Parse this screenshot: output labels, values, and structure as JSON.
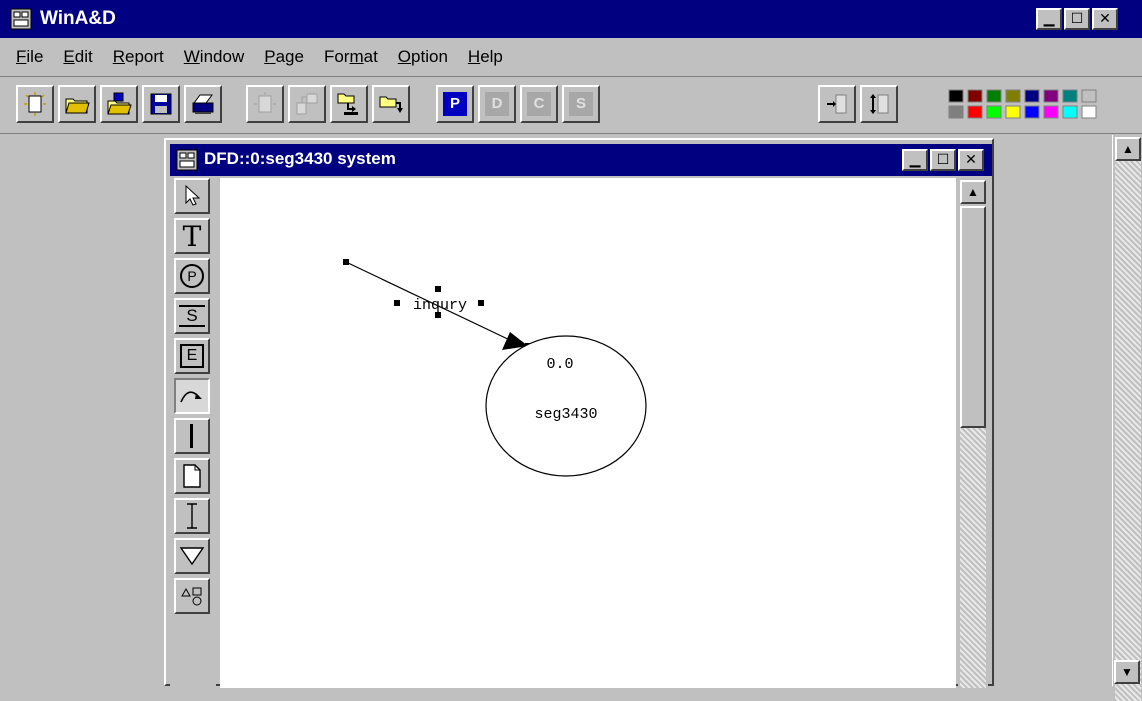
{
  "app": {
    "title": "WinA&D"
  },
  "menu": [
    {
      "pre": "",
      "u": "F",
      "post": "ile"
    },
    {
      "pre": "",
      "u": "E",
      "post": "dit"
    },
    {
      "pre": "",
      "u": "R",
      "post": "eport"
    },
    {
      "pre": "",
      "u": "W",
      "post": "indow"
    },
    {
      "pre": "",
      "u": "P",
      "post": "age"
    },
    {
      "pre": "For",
      "u": "m",
      "post": "at"
    },
    {
      "pre": "",
      "u": "O",
      "post": "ption"
    },
    {
      "pre": "",
      "u": "H",
      "post": "elp"
    }
  ],
  "toolbar": {
    "buttons": [
      "new-icon",
      "open-folder-icon",
      "open-diagram-icon",
      "save-icon",
      "print-icon",
      "disabled-new-icon",
      "disabled-link-icon",
      "folder-import-icon",
      "folder-export-icon"
    ],
    "letter_buttons": [
      "P",
      "D",
      "C",
      "S"
    ],
    "swatches": [
      "#000000",
      "#800000",
      "#008000",
      "#808000",
      "#000080",
      "#800080",
      "#008080",
      "#c0c0c0",
      "#808080",
      "#ff0000",
      "#00ff00",
      "#ffff00",
      "#0000ff",
      "#ff00ff",
      "#00ffff",
      "#ffffff"
    ]
  },
  "child": {
    "title": "DFD::0:seg3430 system"
  },
  "palette": {
    "tools": [
      "pointer-icon",
      "text-tool-icon",
      "process-tool-icon",
      "store-tool-icon",
      "entity-tool-icon",
      "flow-tool-icon",
      "line-tool-icon",
      "page-tool-icon",
      "ibeam-tool-icon",
      "triangle-tool-icon",
      "shapes-tool-icon"
    ],
    "labels": {
      "text": "T",
      "process": "P",
      "store": "S",
      "entity": "E"
    }
  },
  "diagram": {
    "process": {
      "number": "0.0",
      "name": "seg3430"
    },
    "flow": {
      "label": "inqury"
    }
  }
}
